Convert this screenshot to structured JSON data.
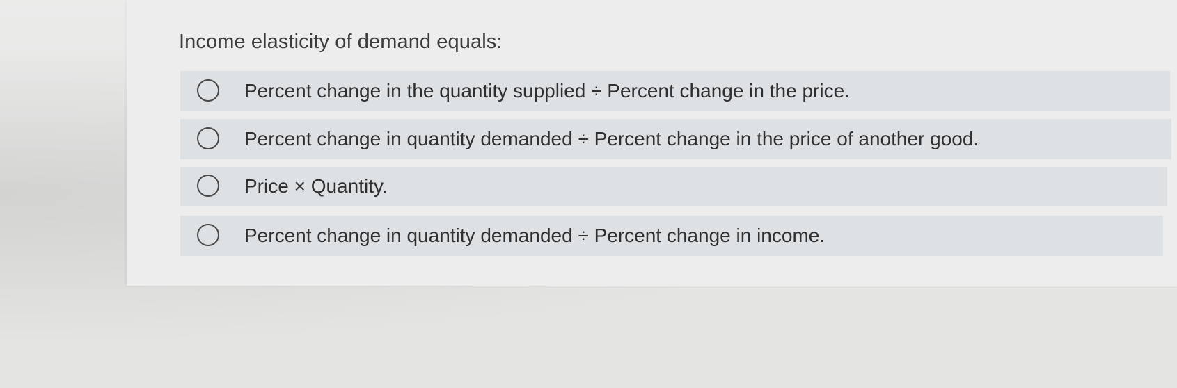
{
  "question": {
    "text": "Income elasticity of demand equals:"
  },
  "options": [
    {
      "label": "Percent change in the quantity supplied ÷ Percent change in the price.",
      "selected": false
    },
    {
      "label": "Percent change in quantity demanded ÷ Percent change in the price of another good.",
      "selected": false
    },
    {
      "label": "Price × Quantity.",
      "selected": false
    },
    {
      "label": "Percent change in quantity demanded ÷ Percent change in income.",
      "selected": false
    }
  ],
  "colors": {
    "option_background": "#dde1e4",
    "card_background": "#ecedec",
    "text": "#2e2f31"
  }
}
